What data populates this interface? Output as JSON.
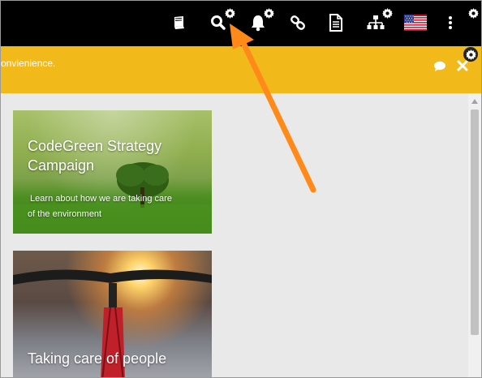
{
  "toolbar": {
    "icons": [
      {
        "name": "book-icon"
      },
      {
        "name": "search-icon"
      },
      {
        "name": "bell-icon"
      },
      {
        "name": "link-icon"
      },
      {
        "name": "document-icon"
      },
      {
        "name": "sitemap-icon"
      },
      {
        "name": "us-flag-icon"
      },
      {
        "name": "more-vertical-icon"
      }
    ],
    "gear_icon": "gear-icon"
  },
  "banner": {
    "text": "onvienience.",
    "background": "#f2b91b"
  },
  "cards": [
    {
      "title_line1": "CodeGreen Strategy",
      "title_line2": "Campaign",
      "subtitle_line1": " Learn about how we are taking care",
      "subtitle_line2": "of the environment"
    },
    {
      "title_line1": "Taking care of people"
    }
  ],
  "annotation": {
    "arrow_color": "#ff8a1a"
  }
}
